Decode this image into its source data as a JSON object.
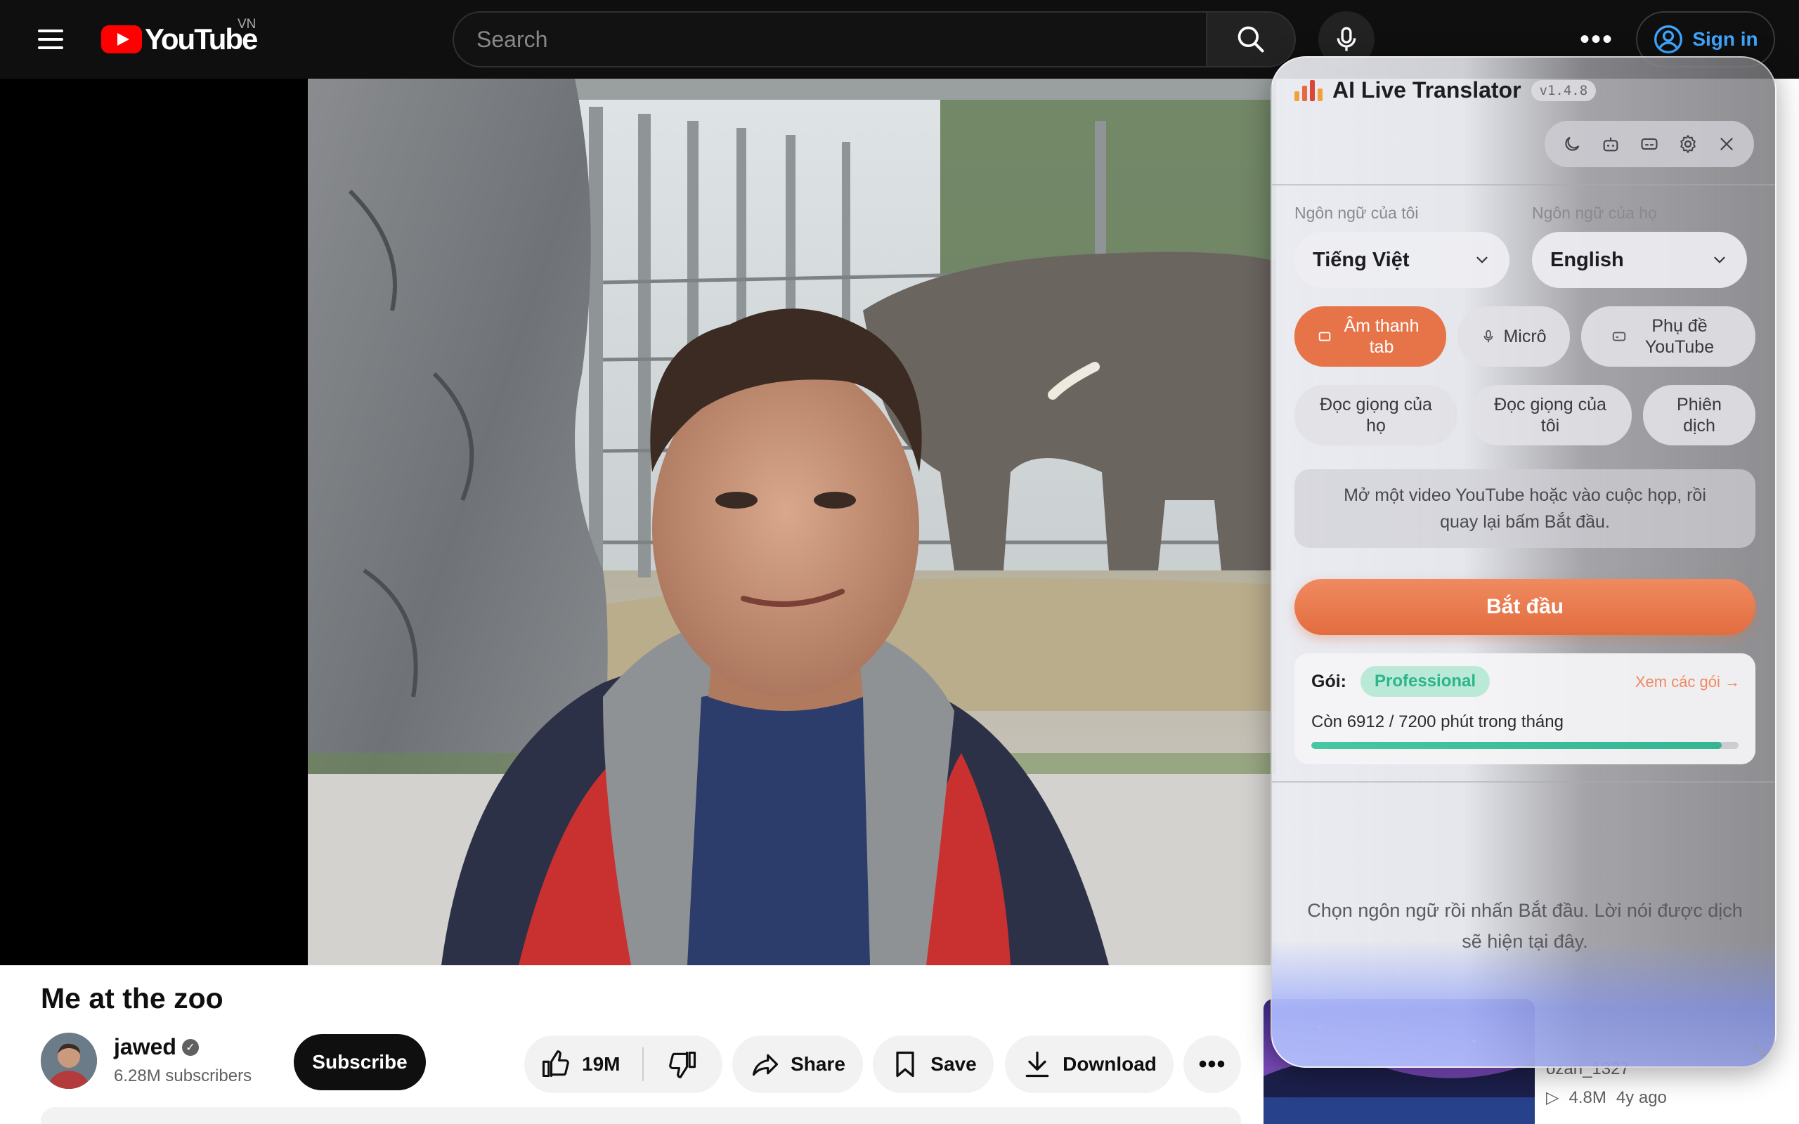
{
  "header": {
    "logo_text": "YouTube",
    "region": "VN",
    "search_placeholder": "Search",
    "signin_label": "Sign in",
    "more_label": "•••"
  },
  "video": {
    "title": "Me at the zoo",
    "channel": "jawed",
    "subscribers": "6.28M subscribers",
    "subscribe_label": "Subscribe",
    "likes": "19M",
    "share_label": "Share",
    "save_label": "Save",
    "download_label": "Download",
    "more_label": "•••"
  },
  "recommended": {
    "channel": "ozan_1327",
    "views": "4.8M",
    "age": "4y ago"
  },
  "translator": {
    "title": "AI Live Translator",
    "version": "v1.4.8",
    "my_lang_label": "Ngôn ngữ của tôi",
    "their_lang_label": "Ngôn ngữ của họ",
    "my_lang": "Tiếng Việt",
    "their_lang": "English",
    "modes": {
      "tab_audio": "Âm thanh tab",
      "mic": "Micrô",
      "yt_subs": "Phụ đề YouTube",
      "read_theirs": "Đọc giọng của họ",
      "read_mine": "Đọc giọng của tôi",
      "interpret": "Phiên dịch"
    },
    "info": "Mở một video YouTube hoặc vào cuộc họp, rồi quay lại bấm Bắt đầu.",
    "start_label": "Bắt đầu",
    "plan_label": "Gói:",
    "plan_name": "Professional",
    "plan_link": "Xem các gói →",
    "remaining": "Còn 6912 / 7200 phút trong tháng",
    "minutes_left": 6912,
    "minutes_total": 7200,
    "hint": "Chọn ngôn ngữ rồi nhấn Bắt đầu. Lời nói được dịch sẽ hiện tại đây.",
    "resize_glyph": "⤡"
  },
  "colors": {
    "yt_red": "#ff0000",
    "link_blue": "#3ea6ff",
    "accent_orange": "#e77449",
    "plan_green": "#2bb58a"
  }
}
